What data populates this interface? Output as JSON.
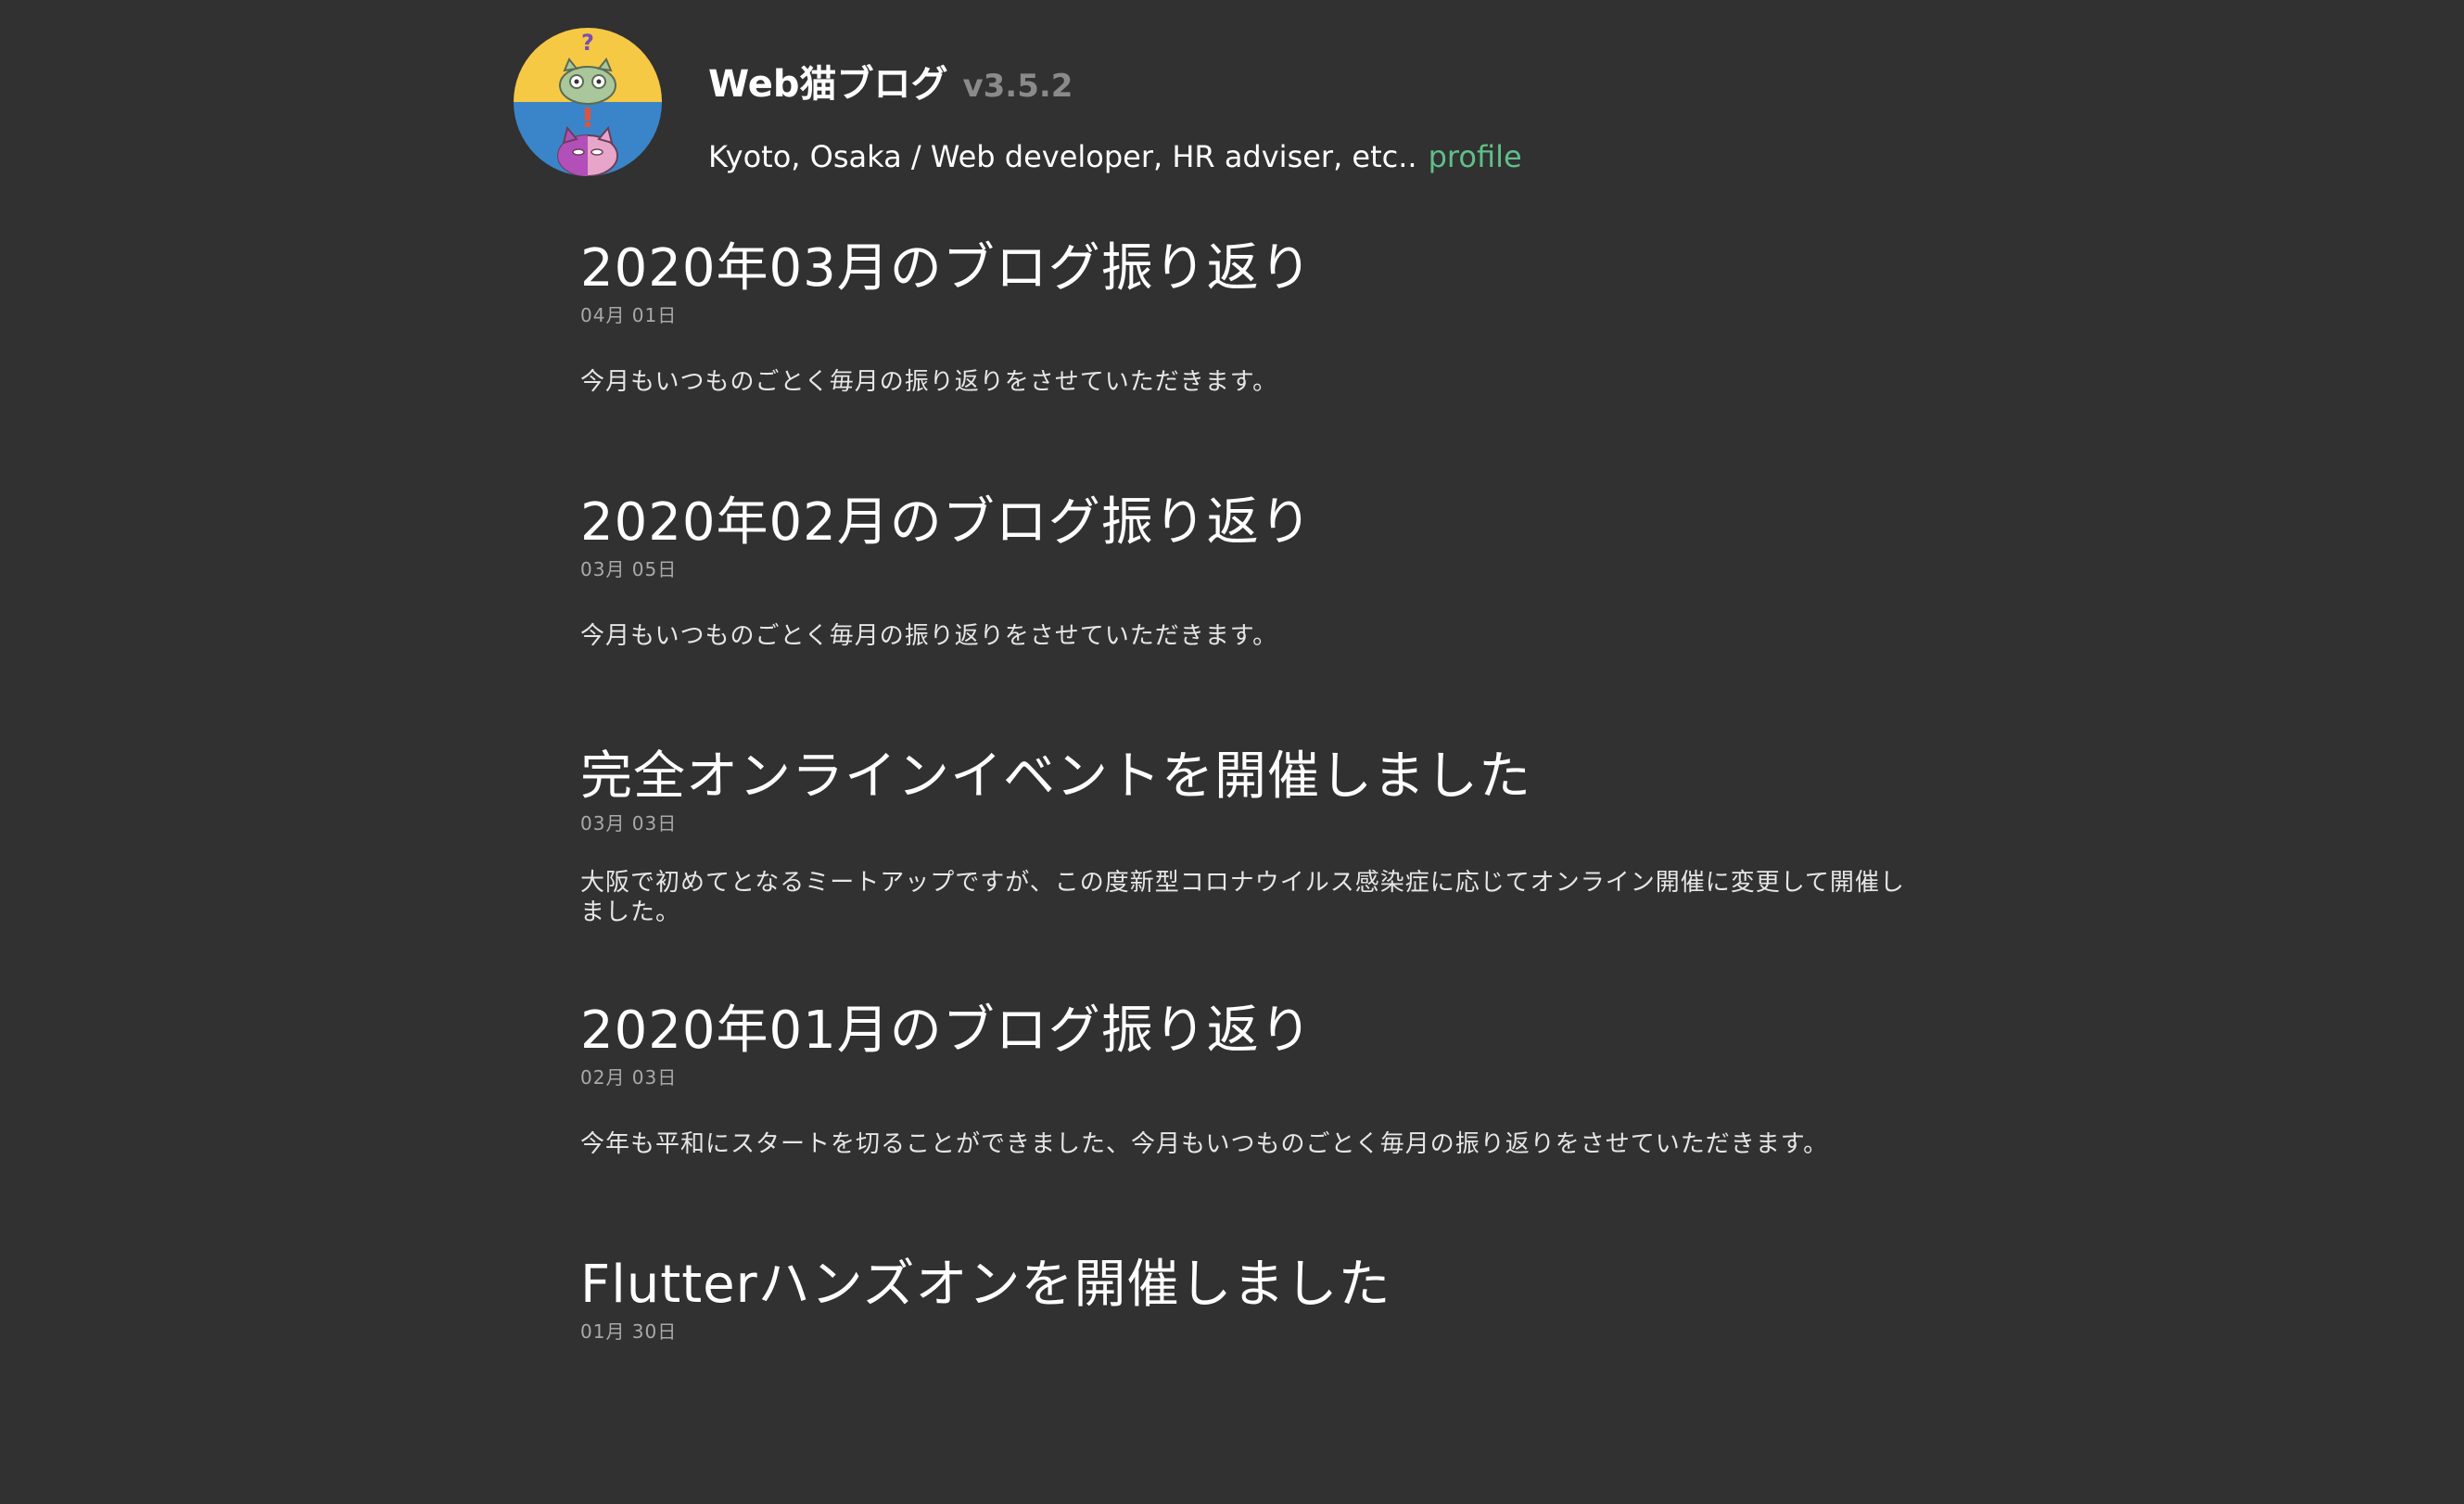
{
  "header": {
    "title": "Web猫ブログ",
    "version": "v3.5.2",
    "tagline": "Kyoto, Osaka / Web developer, HR adviser, etc..",
    "profile_link": "profile",
    "avatar_colors": {
      "top": "#F6C945",
      "bottom": "#3A85C9",
      "question_mark": "#7A4FB0",
      "exclamation_mark": "#E0533A"
    }
  },
  "colors": {
    "background": "#313131",
    "text": "#FFFFFF",
    "muted": "#8A8A8A",
    "link": "#5FBF8A"
  },
  "posts": [
    {
      "title": "2020年03月のブログ振り返り",
      "date": "04月 01日",
      "excerpt": "今月もいつものごとく毎月の振り返りをさせていただきます。"
    },
    {
      "title": "2020年02月のブログ振り返り",
      "date": "03月 05日",
      "excerpt": "今月もいつものごとく毎月の振り返りをさせていただきます。"
    },
    {
      "title": "完全オンラインイベントを開催しました",
      "date": "03月 03日",
      "excerpt": "大阪で初めてとなるミートアップですが、この度新型コロナウイルス感染症に応じてオンライン開催に変更して開催しました。"
    },
    {
      "title": "2020年01月のブログ振り返り",
      "date": "02月 03日",
      "excerpt": "今年も平和にスタートを切ることができました、今月もいつものごとく毎月の振り返りをさせていただきます。"
    },
    {
      "title": "Flutterハンズオンを開催しました",
      "date": "01月 30日",
      "excerpt": ""
    }
  ]
}
